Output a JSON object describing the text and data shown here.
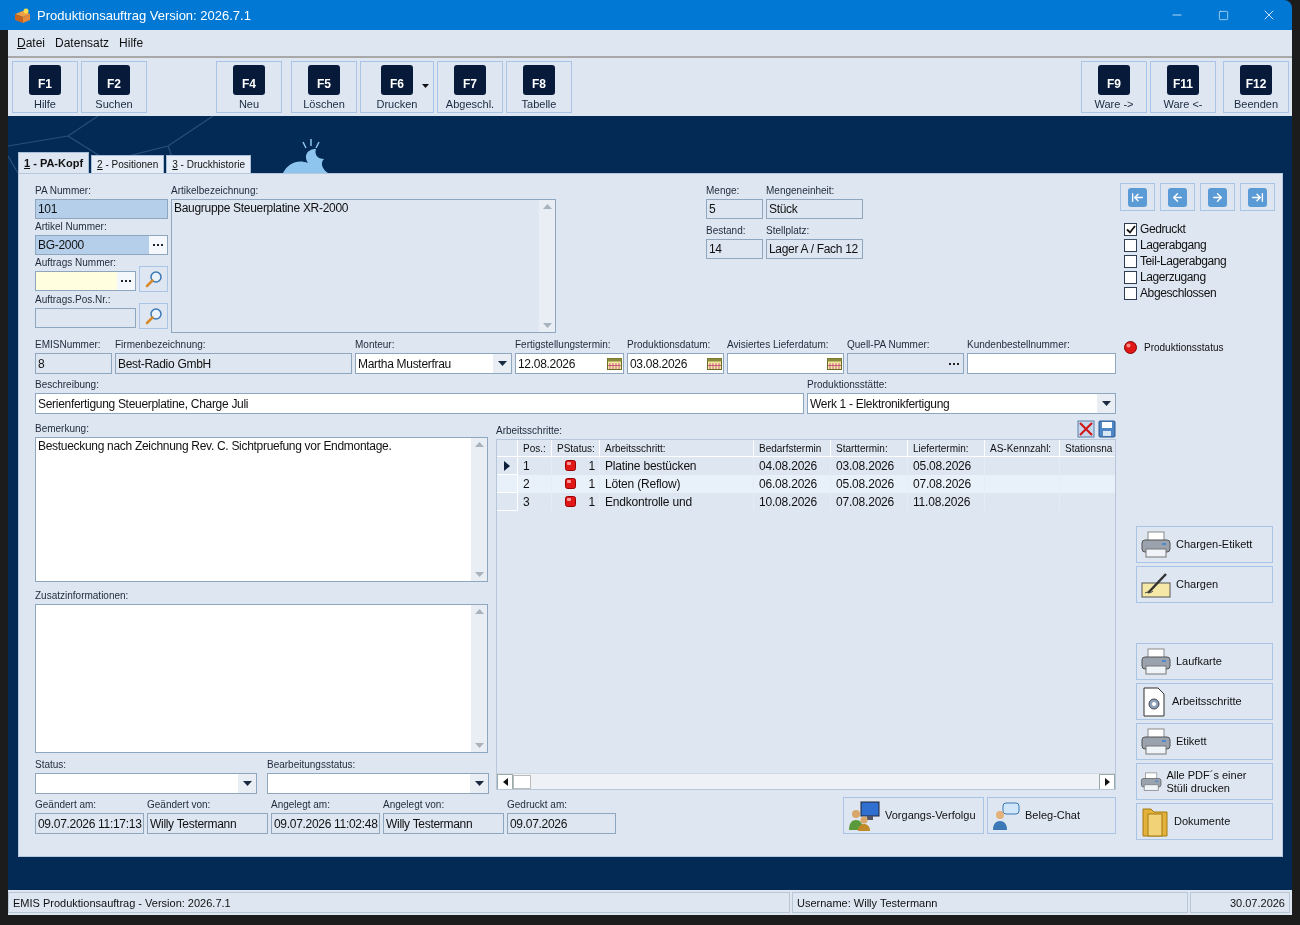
{
  "window": {
    "title": "Produktionsauftrag Version: 2026.7.1"
  },
  "menu": [
    {
      "label": "Datei",
      "mnemonic": true
    },
    {
      "label": "Datensatz",
      "mnemonic": false
    },
    {
      "label": "Hilfe",
      "mnemonic": false
    }
  ],
  "toolbar": {
    "left": [
      [
        {
          "key": "F1",
          "label": "Hilfe"
        },
        {
          "key": "F2",
          "label": "Suchen"
        }
      ],
      [
        {
          "key": "F4",
          "label": "Neu"
        }
      ],
      [
        {
          "key": "F5",
          "label": "Löschen"
        },
        {
          "key": "F6",
          "label": "Drucken",
          "dropdown": true
        },
        {
          "key": "F7",
          "label": "Abgeschl."
        },
        {
          "key": "F8",
          "label": "Tabelle"
        }
      ]
    ],
    "right": [
      [
        {
          "key": "F9",
          "label": "Ware ->"
        },
        {
          "key": "F11",
          "label": "Ware <-"
        }
      ],
      [
        {
          "key": "F12",
          "label": "Beenden"
        }
      ]
    ]
  },
  "tabs": [
    {
      "label": "1 - PA-Kopf",
      "selected": true
    },
    {
      "label": "2 - Positionen",
      "selected": false
    },
    {
      "label": "3 - Druckhistorie",
      "selected": false
    }
  ],
  "form": {
    "left_fields": [
      {
        "label": "PA Nummer:",
        "value": "101",
        "kind": "text",
        "highlighted": true,
        "readonly": true
      },
      {
        "label": "Artikel Nummer:",
        "value": "BG-2000",
        "kind": "browse",
        "highlighted": true
      },
      {
        "label": "Auftrags Nummer:",
        "kind": "browse",
        "required": true,
        "search": true
      },
      {
        "label": "Auftrags.Pos.Nr.:",
        "kind": "text",
        "readonly": true,
        "search": true
      }
    ],
    "artikelbezeichnung": {
      "label": "Artikelbezeichnung:",
      "value": "Baugruppe Steuerplatine XR-2000",
      "kind": "memo",
      "readonly": true
    },
    "stock_fields": [
      {
        "label": "Menge:",
        "value": "5",
        "kind": "text",
        "readonly": true
      },
      {
        "label": "Mengeneinheit:",
        "value": "Stück",
        "kind": "text",
        "readonly": true
      },
      {
        "label": "Bestand:",
        "value": "14",
        "kind": "text",
        "readonly": true
      },
      {
        "label": "Stellplatz:",
        "value": "Lager A / Fach 12",
        "kind": "text",
        "readonly": true
      }
    ],
    "row_fields": [
      {
        "label": "EMISNummer:",
        "value": "8",
        "kind": "text",
        "readonly": true
      },
      {
        "label": "Firmenbezeichnung:",
        "value": "Best-Radio GmbH",
        "kind": "text",
        "readonly": true
      },
      {
        "label": "Monteur:",
        "value": "Martha Musterfrau",
        "kind": "combo"
      },
      {
        "label": "Fertigstellungstermin:",
        "value": "12.08.2026",
        "kind": "date"
      },
      {
        "label": "Produktionsdatum:",
        "value": "03.08.2026",
        "kind": "date"
      },
      {
        "label": "Avisiertes Lieferdatum:",
        "kind": "date"
      },
      {
        "label": "Quell-PA Nummer:",
        "kind": "browse",
        "readonly": true
      },
      {
        "label": "Kundenbestellnummer:",
        "kind": "text"
      }
    ],
    "beschreibung": {
      "label": "Beschreibung:",
      "value": "Serienfertigung Steuerplatine, Charge Juli",
      "kind": "text"
    },
    "produktionsstaette": {
      "label": "Produktionsstätte:",
      "value": "Werk 1 - Elektronikfertigung",
      "kind": "combo"
    },
    "bemerkung": {
      "label": "Bemerkung:",
      "value": "Bestueckung nach Zeichnung Rev. C. Sichtpruefung vor Endmontage.",
      "kind": "memo"
    },
    "zusatzinformationen": {
      "label": "Zusatzinformationen:",
      "kind": "memo"
    },
    "status_fields": [
      {
        "label": "Status:",
        "kind": "combo"
      },
      {
        "label": "Bearbeitungsstatus:",
        "kind": "combo"
      }
    ],
    "audit_fields": [
      {
        "label": "Geändert am:",
        "value": "09.07.2026 11:17:13",
        "kind": "text",
        "readonly": true
      },
      {
        "label": "Geändert von:",
        "value": "Willy Testermann",
        "kind": "text",
        "readonly": true
      },
      {
        "label": "Angelegt am:",
        "value": "09.07.2026 11:02:48",
        "kind": "text",
        "readonly": true
      },
      {
        "label": "Angelegt von:",
        "value": "Willy Testermann",
        "kind": "text",
        "readonly": true
      },
      {
        "label": "Gedruckt am:",
        "value": "09.07.2026",
        "kind": "text",
        "readonly": true
      }
    ]
  },
  "flags": [
    {
      "label": "Gedruckt",
      "checked": true
    },
    {
      "label": "Lagerabgang",
      "checked": false
    },
    {
      "label": "Teil-Lagerabgang",
      "checked": false
    },
    {
      "label": "Lagerzugang",
      "checked": false
    },
    {
      "label": "Abgeschlossen",
      "checked": false
    }
  ],
  "production_status": {
    "label": "Produktionsstatus"
  },
  "arbeitsschritte": {
    "title": "Arbeitsschritte:",
    "columns": [
      {
        "label": "Pos.:",
        "kind": "text"
      },
      {
        "label": "PStatus:",
        "kind": "status"
      },
      {
        "label": "Arbeitsschritt:",
        "kind": "text"
      },
      {
        "label": "Bedarfstermin",
        "kind": "text"
      },
      {
        "label": "Starttermin:",
        "kind": "text"
      },
      {
        "label": "Liefertermin:",
        "kind": "text"
      },
      {
        "label": "AS-Kennzahl:",
        "kind": "text"
      },
      {
        "label": "Stationsna",
        "kind": "text"
      }
    ],
    "rows": [
      {
        "cells": [
          "1",
          "1",
          "Platine bestücken",
          "04.08.2026",
          "03.08.2026",
          "05.08.2026"
        ],
        "selected": true
      },
      {
        "cells": [
          "2",
          "1",
          "Löten (Reflow)",
          "06.08.2026",
          "05.08.2026",
          "07.08.2026"
        ],
        "selected": false
      },
      {
        "cells": [
          "3",
          "1",
          "Endkontrolle und",
          "10.08.2026",
          "07.08.2026",
          "11.08.2026"
        ],
        "selected": false
      }
    ]
  },
  "side_buttons": [
    [
      {
        "label": "Chargen-Etikett",
        "kind": "printer"
      },
      {
        "label": "Chargen",
        "kind": "signature"
      }
    ],
    [
      {
        "label": "Laufkarte",
        "kind": "printer"
      },
      {
        "label": "Arbeitsschritte",
        "kind": "document"
      },
      {
        "label": "Etikett",
        "kind": "printer"
      },
      {
        "label": "Alle PDF´s einer Stüli drucken",
        "kind": "printer"
      },
      {
        "label": "Dokumente",
        "kind": "folder"
      }
    ]
  ],
  "bottom_buttons": [
    {
      "label": "Vorgangs-Verfolgu",
      "kind": "users"
    },
    {
      "label": "Beleg-Chat",
      "kind": "chat"
    }
  ],
  "status_bar": {
    "app": "EMIS Produktionsauftrag - Version: 2026.7.1",
    "user": "Username: Willy Testermann",
    "date": "30.07.2026"
  }
}
